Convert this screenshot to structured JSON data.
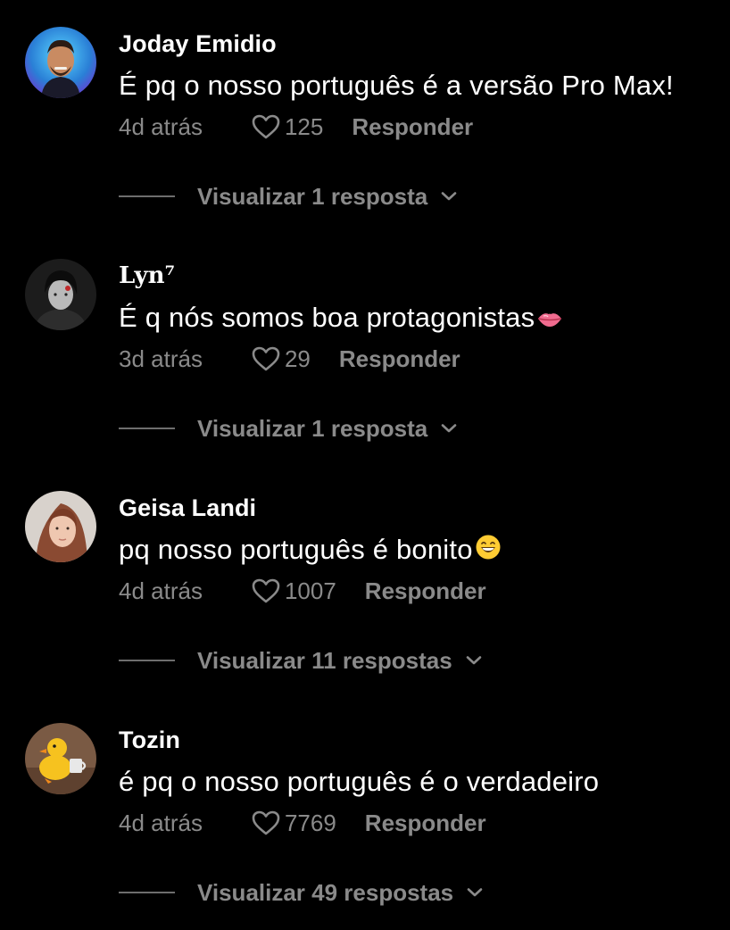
{
  "comments": [
    {
      "username": "Joday Emidio",
      "text": "É pq o nosso português é a versão Pro Max!",
      "time": "4d atrás",
      "likes": "125",
      "reply_label": "Responder",
      "thread_label": "Visualizar 1 resposta"
    },
    {
      "username": "Lyn⁷",
      "text": "É q nós somos boa protagonistas",
      "emoji": "lips-emoji",
      "time": "3d atrás",
      "likes": "29",
      "reply_label": "Responder",
      "thread_label": "Visualizar 1 resposta"
    },
    {
      "username": "Geisa Landi",
      "text": "pq nosso português é bonito",
      "emoji": "grinning-face-emoji",
      "time": "4d atrás",
      "likes": "1007",
      "reply_label": "Responder",
      "thread_label": "Visualizar 11 respostas"
    },
    {
      "username": "Tozin",
      "text": "é pq o nosso português é o verdadeiro",
      "time": "4d atrás",
      "likes": "7769",
      "reply_label": "Responder",
      "thread_label": "Visualizar 49 respostas"
    }
  ],
  "icons": {
    "like": "heart-outline-icon",
    "expand": "chevron-down-icon"
  },
  "colors": {
    "background": "#000000",
    "primary_text": "#ffffff",
    "secondary_text": "#8a8a8a"
  }
}
